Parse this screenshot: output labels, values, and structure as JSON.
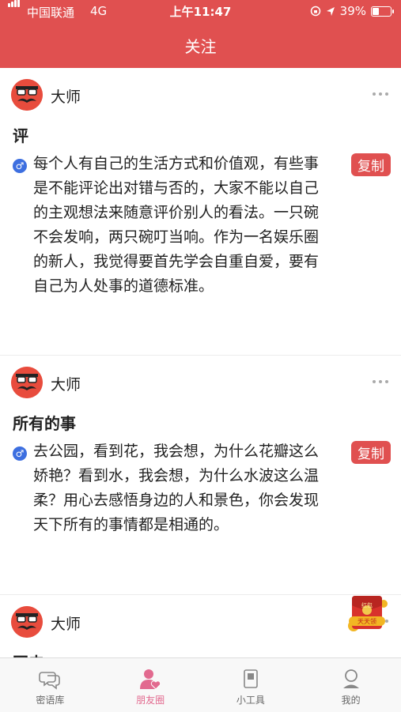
{
  "status_bar": {
    "carrier": "中国联通",
    "network": "4G",
    "time": "上午11:47",
    "battery": "39%"
  },
  "nav": {
    "title": "关注"
  },
  "posts": [
    {
      "author": "大师",
      "title": "评",
      "body": "每个人有自己的生活方式和价值观，有些事是不能评论出对错与否的，大家不能以自己的主观想法来随意评价别人的看法。一只碗不会发响，两只碗叮当响。作为一名娱乐圈的新人，我觉得要首先学会自重自爱，要有自己为人处事的道德标准。",
      "copy_label": "复制"
    },
    {
      "author": "大师",
      "title": "所有的事",
      "body": "去公园，看到花，我会想，为什么花瓣这么娇艳？看到水，我会想，为什么水波这么温柔？用心去感悟身边的人和景色，你会发现天下所有的事情都是相通的。",
      "copy_label": "复制"
    },
    {
      "author": "大师",
      "title": "回夫"
    }
  ],
  "tabs": [
    {
      "label": "密语库",
      "icon": "chat-bubbles-icon"
    },
    {
      "label": "朋友圈",
      "icon": "person-heart-icon"
    },
    {
      "label": "小工具",
      "icon": "notebook-icon"
    },
    {
      "label": "我的",
      "icon": "profile-icon"
    }
  ],
  "floating_ad": {
    "icon": "red-envelope-icon",
    "text_top": "红包",
    "text_bottom": "天天领"
  },
  "colors": {
    "accent": "#e05050",
    "active_tab": "#e26a8f",
    "gender_icon": "#3d6fe0"
  }
}
